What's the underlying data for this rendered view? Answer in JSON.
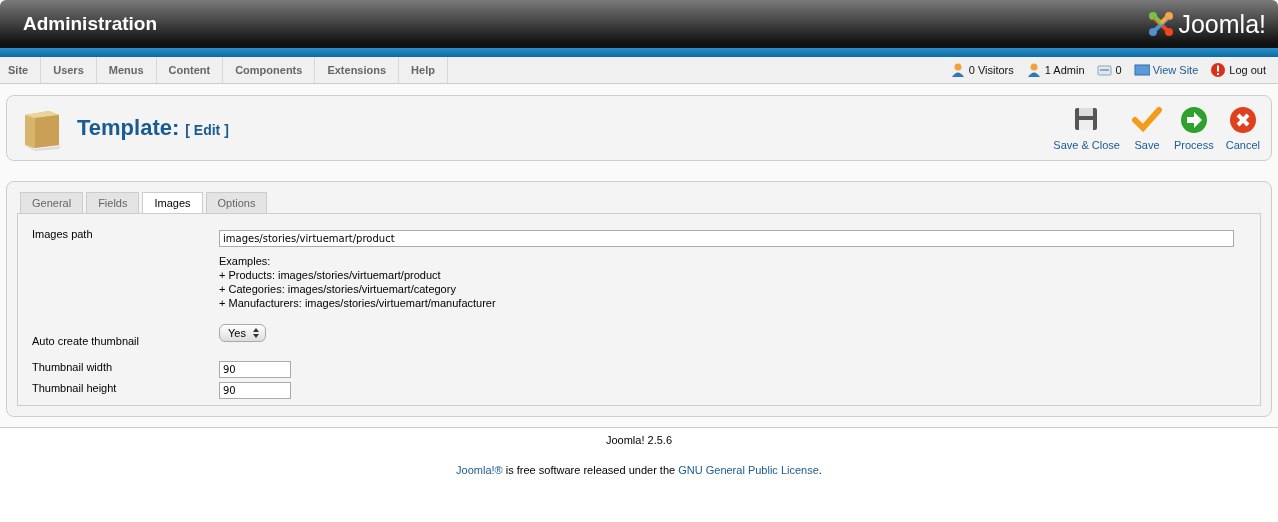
{
  "header": {
    "title": "Administration",
    "logo_text": "Joomla!"
  },
  "menu": [
    {
      "label": "Site"
    },
    {
      "label": "Users"
    },
    {
      "label": "Menus"
    },
    {
      "label": "Content"
    },
    {
      "label": "Components"
    },
    {
      "label": "Extensions"
    },
    {
      "label": "Help"
    }
  ],
  "status": [
    {
      "kind": "visitors",
      "label": "0 Visitors"
    },
    {
      "kind": "admin",
      "label": "1 Admin"
    },
    {
      "kind": "messages",
      "label": "0"
    },
    {
      "kind": "viewsite",
      "label": "View Site"
    },
    {
      "kind": "logout",
      "label": "Log out"
    }
  ],
  "toolbar": {
    "title": "Template:",
    "subtitle": "[ Edit ]",
    "buttons": [
      {
        "kind": "save-close",
        "label": "Save & Close"
      },
      {
        "kind": "save",
        "label": "Save"
      },
      {
        "kind": "process",
        "label": "Process"
      },
      {
        "kind": "cancel",
        "label": "Cancel"
      }
    ]
  },
  "tabs": [
    {
      "label": "General",
      "selected": false
    },
    {
      "label": "Fields",
      "selected": false
    },
    {
      "label": "Images",
      "selected": true
    },
    {
      "label": "Options",
      "selected": false
    }
  ],
  "form": [
    {
      "kind": "text",
      "label": "Images path",
      "value": "images/stories/virtuemart/product",
      "help": [
        "Examples:",
        "+ Products: images/stories/virtuemart/product",
        "+ Categories: images/stories/virtuemart/category",
        "+ Manufacturers: images/stories/virtuemart/manufacturer"
      ]
    },
    {
      "kind": "select",
      "label": "Auto create thumbnail",
      "value": "Yes"
    },
    {
      "kind": "small",
      "label": "Thumbnail width",
      "value": "90"
    },
    {
      "kind": "small",
      "label": "Thumbnail height",
      "value": "90"
    }
  ],
  "footer": {
    "version": "Joomla! 2.5.6",
    "license": [
      {
        "kind": "link",
        "text": "Joomla!®"
      },
      {
        "kind": "text",
        "text": " is free software released under the "
      },
      {
        "kind": "link",
        "text": "GNU General Public License"
      },
      {
        "kind": "text",
        "text": "."
      }
    ]
  }
}
